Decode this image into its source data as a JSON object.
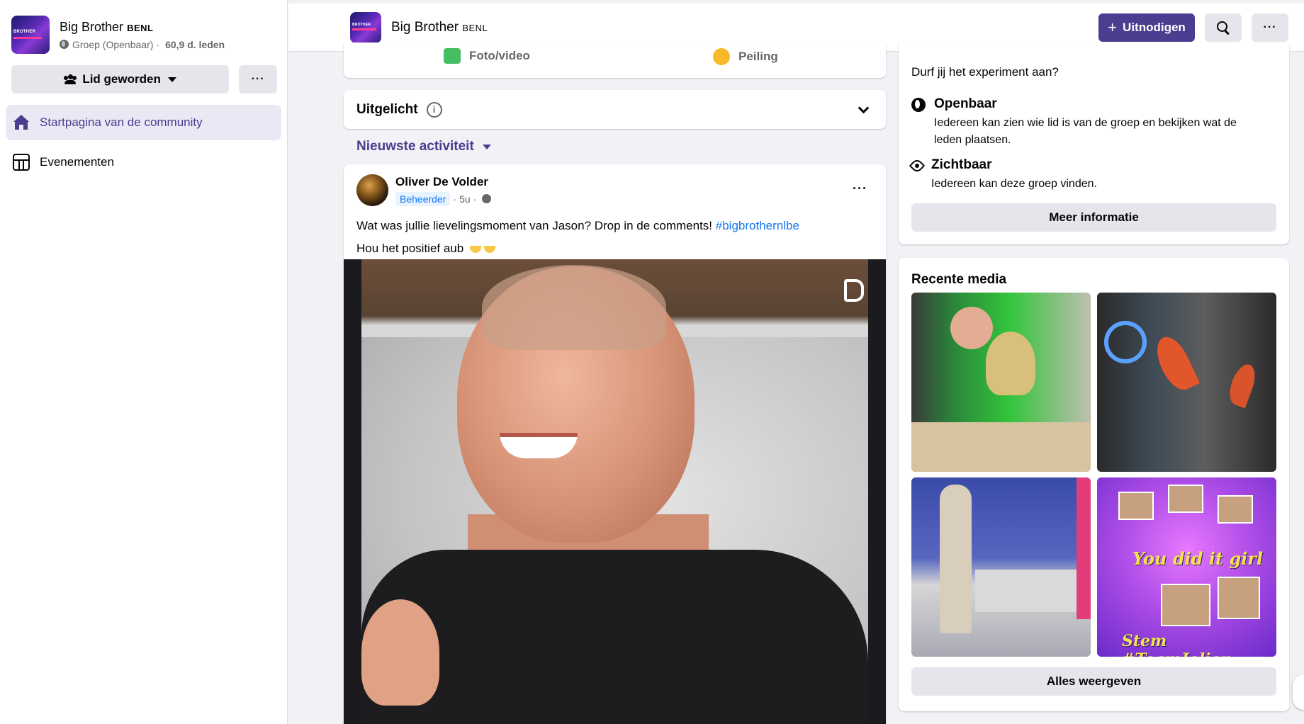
{
  "group": {
    "name": "Big Brother",
    "name_suffix": "BENL",
    "privacy": "Groep (Openbaar)",
    "separator": "·",
    "members": "60,9 d. leden"
  },
  "sidebar": {
    "join_label": "Lid geworden",
    "more_label": "···",
    "items": [
      {
        "label": "Startpagina van de community",
        "icon": "home-icon",
        "active": true
      },
      {
        "label": "Evenementen",
        "icon": "calendar-icon",
        "active": false
      }
    ]
  },
  "header": {
    "title": "Big Brother",
    "title_suffix": "BENL",
    "invite_label": "Uitnodigen",
    "more_label": "···"
  },
  "composer": {
    "photo_label": "Foto/video",
    "poll_label": "Peiling"
  },
  "featured": {
    "title": "Uitgelicht",
    "info_glyph": "i"
  },
  "feed": {
    "sort_label": "Nieuwste activiteit"
  },
  "post": {
    "author": "Oliver De Volder",
    "role_badge": "Beheerder",
    "separator": "·",
    "time": "5u",
    "more_label": "···",
    "text_line1": "Wat was jullie lievelingsmoment van Jason? Drop in de comments!",
    "hashtag": "#bigbrothernlbe",
    "text_line2": "Hou het positief aub"
  },
  "about": {
    "question": "Durf jij het experiment aan?",
    "public_title": "Openbaar",
    "public_desc": "Iedereen kan zien wie lid is van de groep en bekijken wat de leden plaatsen.",
    "visible_title": "Zichtbaar",
    "visible_desc": "Iedereen kan deze groep vinden.",
    "more_info_label": "Meer informatie"
  },
  "media": {
    "title": "Recente media",
    "show_all_label": "Alles weergeven",
    "thumb4_text1": "You did it girl",
    "thumb4_text2": "Stem #TeamJolien"
  },
  "colors": {
    "brand": "#4b3d8f",
    "active_bg": "#ebe7f5",
    "link": "#1877f2"
  }
}
